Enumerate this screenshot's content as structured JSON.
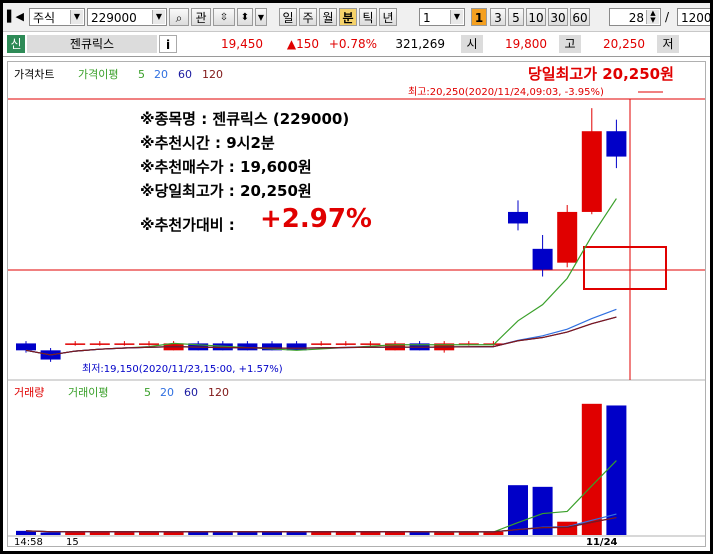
{
  "toolbar": {
    "market_type": "주식",
    "code": "229000",
    "interest_label": "관",
    "period_buttons": [
      "일",
      "주",
      "월",
      "분",
      "틱",
      "년"
    ],
    "active_period": "분",
    "period_count": "1",
    "badge": "1",
    "minute_presets": [
      "3",
      "5",
      "10",
      "30",
      "60"
    ],
    "count_value": "28",
    "slash": "/",
    "total_value": "1200"
  },
  "infobar": {
    "credit_label": "신",
    "stock_name": "젠큐릭스",
    "info_label": "i",
    "price": "19,450",
    "change": "▲150",
    "change_rate": "+0.78%",
    "volume": "321,269",
    "open_label": "시",
    "open_price": "19,800",
    "high_label": "고",
    "high_price": "20,250",
    "low_label": "저"
  },
  "legend_price": {
    "title": "가격차트",
    "ma_label": "가격이평",
    "ma_values": [
      "5",
      "20",
      "60",
      "120"
    ]
  },
  "legend_volume": {
    "title": "거래량",
    "ma_label": "거래이평",
    "ma_values": [
      "5",
      "20",
      "60",
      "120"
    ]
  },
  "annotations": {
    "day_high_title": "당일최고가 20,250원",
    "high_marker": "최고:20,250(2020/11/24,09:03, -3.95%)",
    "low_marker": "최저:19,150(2020/11/23,15:00, +1.57%)",
    "lines": [
      "※종목명 : 젠큐릭스 (229000)",
      "※추천시간 : 9시2분",
      "※추천매수가 : 19,600원",
      "※당일최고가 : 20,250원"
    ],
    "ratio_label": "※추천가대비 :",
    "ratio_value": "+2.97%"
  },
  "x_axis": {
    "labels": [
      "14:58",
      "15",
      "11/24"
    ]
  },
  "colors": {
    "up": "#e00000",
    "down": "#0000c8",
    "ma5": "#3aa02a",
    "ma20": "#3070e0",
    "ma60": "#1a1aa0",
    "ma120": "#801818",
    "highlight": "#e00000"
  },
  "chart_data": {
    "type": "candlestick",
    "price_unit": "원",
    "high": 20250,
    "low": 19150,
    "candles": [
      {
        "o": 19230,
        "c": 19200,
        "h": 19240,
        "l": 19190
      },
      {
        "o": 19200,
        "c": 19160,
        "h": 19210,
        "l": 19150
      },
      {
        "o": 19230,
        "c": 19230,
        "h": 19240,
        "l": 19220
      },
      {
        "o": 19230,
        "c": 19230,
        "h": 19240,
        "l": 19220
      },
      {
        "o": 19230,
        "c": 19230,
        "h": 19240,
        "l": 19220
      },
      {
        "o": 19230,
        "c": 19230,
        "h": 19240,
        "l": 19220
      },
      {
        "o": 19200,
        "c": 19230,
        "h": 19240,
        "l": 19200
      },
      {
        "o": 19230,
        "c": 19200,
        "h": 19240,
        "l": 19200
      },
      {
        "o": 19230,
        "c": 19200,
        "h": 19240,
        "l": 19200
      },
      {
        "o": 19230,
        "c": 19200,
        "h": 19240,
        "l": 19200
      },
      {
        "o": 19230,
        "c": 19200,
        "h": 19240,
        "l": 19200
      },
      {
        "o": 19230,
        "c": 19200,
        "h": 19240,
        "l": 19200
      },
      {
        "o": 19230,
        "c": 19230,
        "h": 19240,
        "l": 19220
      },
      {
        "o": 19230,
        "c": 19230,
        "h": 19240,
        "l": 19220
      },
      {
        "o": 19230,
        "c": 19230,
        "h": 19240,
        "l": 19220
      },
      {
        "o": 19200,
        "c": 19230,
        "h": 19240,
        "l": 19200
      },
      {
        "o": 19230,
        "c": 19200,
        "h": 19240,
        "l": 19200
      },
      {
        "o": 19200,
        "c": 19230,
        "h": 19240,
        "l": 19190
      },
      {
        "o": 19230,
        "c": 19230,
        "h": 19240,
        "l": 19220
      },
      {
        "o": 19230,
        "c": 19230,
        "h": 19240,
        "l": 19220
      },
      {
        "o": 19800,
        "c": 19750,
        "h": 19850,
        "l": 19720
      },
      {
        "o": 19640,
        "c": 19550,
        "h": 19700,
        "l": 19520
      },
      {
        "o": 19580,
        "c": 19800,
        "h": 19830,
        "l": 19560
      },
      {
        "o": 19800,
        "c": 20150,
        "h": 20250,
        "l": 19790
      },
      {
        "o": 20150,
        "c": 20040,
        "h": 20200,
        "l": 19990
      }
    ],
    "volumes": [
      5,
      3,
      4,
      4,
      4,
      4,
      3,
      4,
      4,
      4,
      4,
      4,
      4,
      4,
      4,
      3,
      4,
      3,
      4,
      4,
      60,
      58,
      16,
      158,
      156
    ]
  }
}
